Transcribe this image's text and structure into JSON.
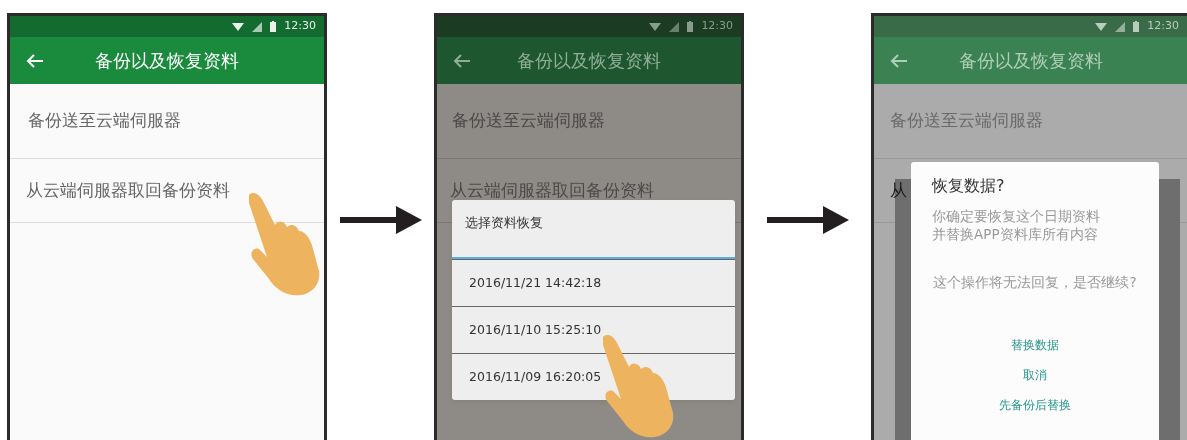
{
  "screens": [
    {
      "dimmed": false,
      "status_bar": {
        "time": "12:30"
      },
      "app_bar": {
        "title": "备份以及恢复资料"
      },
      "items": [
        {
          "label": "备份送至云端伺服器",
          "touched": false
        },
        {
          "label": "从云端伺服器取回备份资料",
          "touched": true
        }
      ]
    },
    {
      "dimmed": true,
      "status_bar": {
        "time": "12:30"
      },
      "app_bar": {
        "title": "备份以及恢复资料"
      },
      "items": [
        {
          "label": "备份送至云端伺服器",
          "touched": false
        },
        {
          "label": "从云端伺服器取回备份资料",
          "touched": false
        }
      ],
      "dialog": {
        "kind": "list",
        "title": "选择资料恢复",
        "options": [
          {
            "label": "2016/11/21 14:42:18",
            "touched": false
          },
          {
            "label": "2016/11/10 15:25:10",
            "touched": true
          },
          {
            "label": "2016/11/09 16:20:05",
            "touched": false
          }
        ]
      }
    },
    {
      "dimmed": true,
      "underlay": true,
      "status_bar": {
        "time": "12:30"
      },
      "app_bar": {
        "title": "备份以及恢复资料"
      },
      "items": [
        {
          "label": "备份送至云端伺服器",
          "touched": false
        },
        {
          "label": "从",
          "touched": false
        }
      ],
      "dialog": {
        "kind": "confirm",
        "title": "恢复数据?",
        "message": [
          "你确定要恢复这个日期资料",
          "并替换APP资料库所有内容"
        ],
        "warning": "这个操作将无法回复，是否继续?",
        "actions": [
          "替换数据",
          "取消",
          "先备份后替换"
        ]
      }
    }
  ]
}
